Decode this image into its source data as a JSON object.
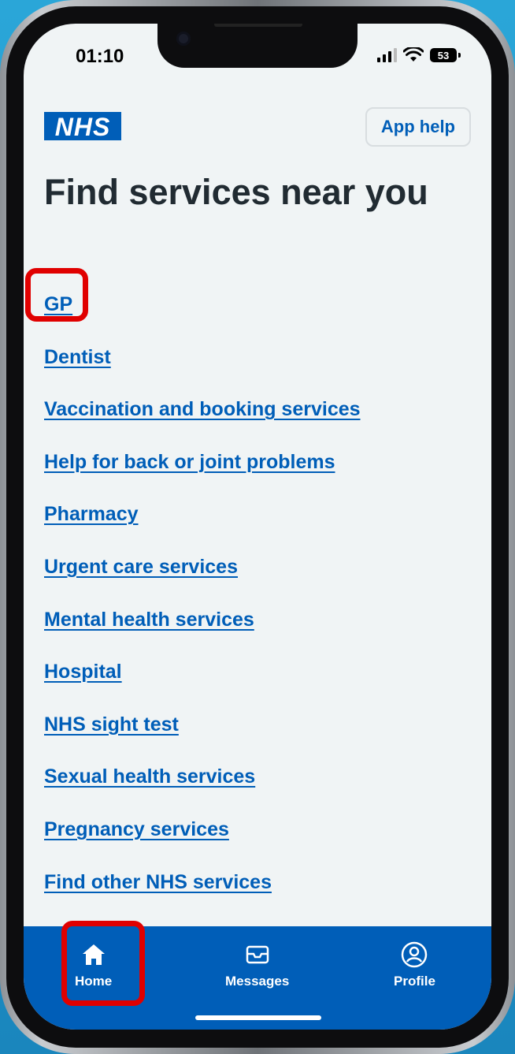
{
  "status_bar": {
    "time": "01:10",
    "battery": "53"
  },
  "header": {
    "logo": "NHS",
    "help_label": "App help"
  },
  "page": {
    "title": "Find services near you"
  },
  "services": [
    "GP",
    "Dentist",
    "Vaccination and booking services",
    "Help for back or joint problems",
    "Pharmacy",
    "Urgent care services",
    "Mental health services",
    "Hospital",
    "NHS sight test",
    "Sexual health services",
    "Pregnancy services",
    "Find other NHS services"
  ],
  "tabbar": {
    "home": "Home",
    "messages": "Messages",
    "profile": "Profile"
  },
  "colors": {
    "nhs_blue": "#005eb8",
    "highlight_red": "#e00000",
    "page_bg": "#f0f4f5",
    "text_dark": "#212b32"
  },
  "icons": {
    "home": "home-icon",
    "messages": "envelope-icon",
    "profile": "user-circle-icon"
  }
}
